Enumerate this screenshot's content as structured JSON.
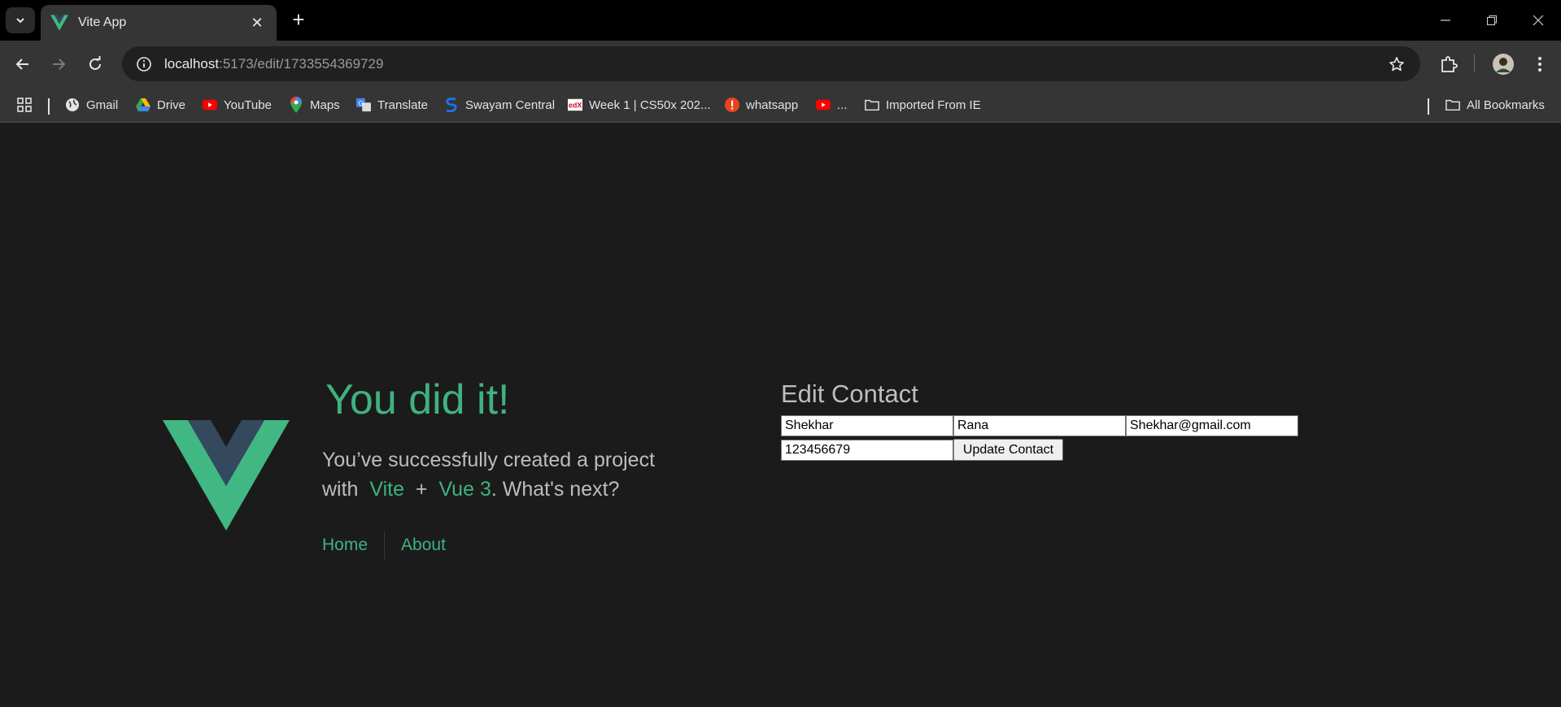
{
  "browser": {
    "tab_title": "Vite App",
    "url_host": "localhost",
    "url_rest": ":5173/edit/1733554369729"
  },
  "bookmarks": [
    {
      "label": "Gmail",
      "icon": "globe-icon"
    },
    {
      "label": "Drive",
      "icon": "drive-icon"
    },
    {
      "label": "YouTube",
      "icon": "youtube-icon"
    },
    {
      "label": "Maps",
      "icon": "maps-icon"
    },
    {
      "label": "Translate",
      "icon": "translate-icon"
    },
    {
      "label": "Swayam Central",
      "icon": "swayam-icon"
    },
    {
      "label": "Week 1 | CS50x 202...",
      "icon": "edx-icon"
    },
    {
      "label": "whatsapp",
      "icon": "alert-icon"
    },
    {
      "label": "...",
      "icon": "youtube-icon"
    },
    {
      "label": "Imported From IE",
      "icon": "folder-icon"
    },
    {
      "label": "All Bookmarks",
      "icon": "folder-icon"
    }
  ],
  "hero": {
    "headline": "You did it!",
    "line1": "You’ve successfully created a project",
    "with": "with",
    "vite": "Vite",
    "plus": "+",
    "vue": "Vue 3",
    "next": ". What's next?"
  },
  "nav": {
    "home": "Home",
    "about": "About"
  },
  "edit": {
    "title": "Edit Contact",
    "first_name": "Shekhar",
    "last_name": "Rana",
    "email": "Shekhar@gmail.com",
    "phone": "123456679",
    "button": "Update Contact"
  },
  "colors": {
    "vue_green": "#3fb27f",
    "vue_dark": "#35495e",
    "page_bg": "#1b1b1b"
  }
}
